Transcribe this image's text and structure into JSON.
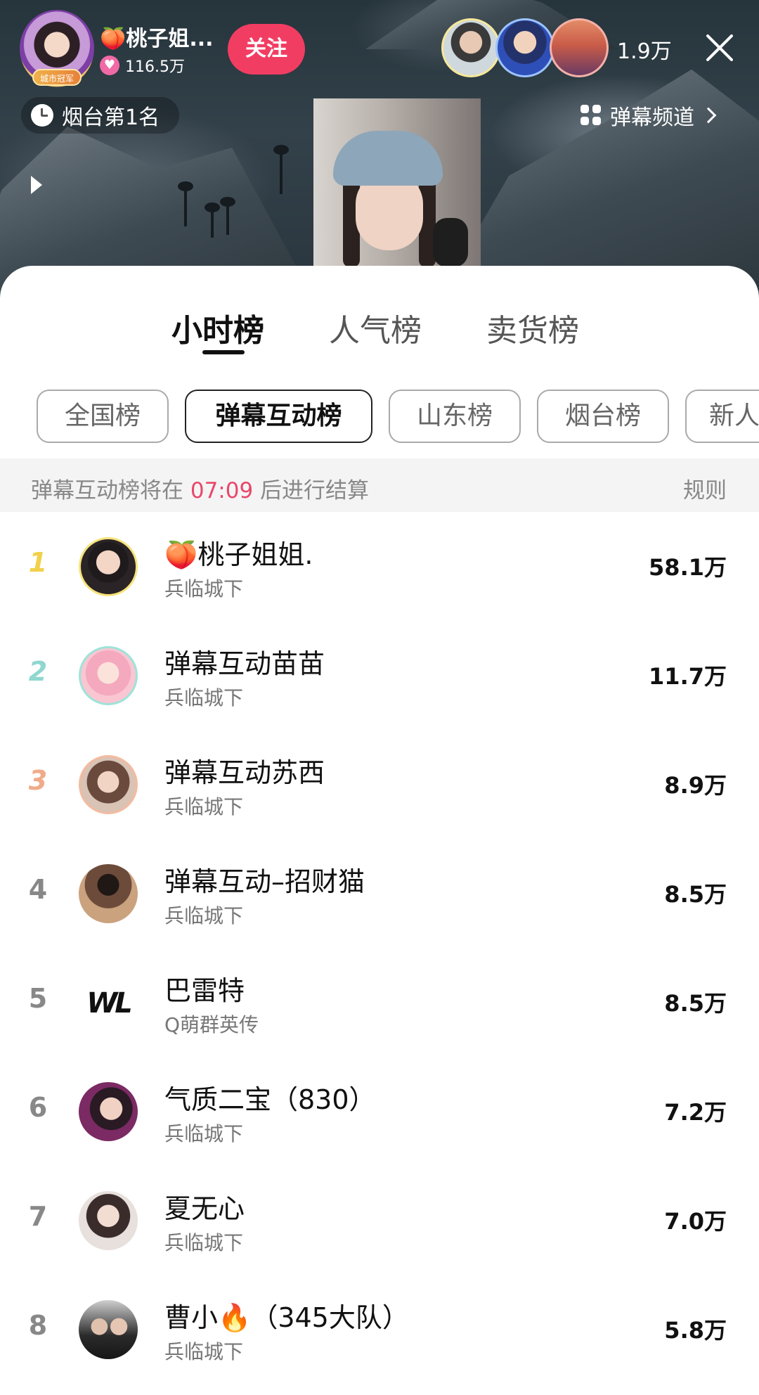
{
  "live_room": {
    "streamer_name": "🍑桃子姐...",
    "streamer_badge": "城市冠军",
    "likes": "116.5万",
    "follow_label": "关注",
    "viewer_count": "1.9万",
    "city_rank": "烟台第1名",
    "danmu_channel": "弹幕频道"
  },
  "icons": {
    "heart": "♥",
    "close": "close-icon",
    "clock": "clock-icon",
    "grid": "grid-icon",
    "chevron": "chevron-right-icon",
    "play": "play-icon"
  },
  "main_tabs": [
    {
      "label": "小时榜",
      "active": true
    },
    {
      "label": "人气榜",
      "active": false
    },
    {
      "label": "卖货榜",
      "active": false
    }
  ],
  "sub_tabs": [
    {
      "label": "全国榜",
      "active": false
    },
    {
      "label": "弹幕互动榜",
      "active": true
    },
    {
      "label": "山东榜",
      "active": false
    },
    {
      "label": "烟台榜",
      "active": false
    },
    {
      "label": "新人",
      "active": false
    }
  ],
  "notice": {
    "prefix": "弹幕互动榜将在",
    "time": "07:09",
    "suffix": "后进行结算",
    "rules_label": "规则"
  },
  "ranking": [
    {
      "rank": "1",
      "name": "🍑桃子姐姐.",
      "subtitle": "兵临城下",
      "score": "58.1万"
    },
    {
      "rank": "2",
      "name": "弹幕互动苗苗",
      "subtitle": "兵临城下",
      "score": "11.7万"
    },
    {
      "rank": "3",
      "name": "弹幕互动苏西",
      "subtitle": "兵临城下",
      "score": "8.9万"
    },
    {
      "rank": "4",
      "name": "弹幕互动–招财猫",
      "subtitle": "兵临城下",
      "score": "8.5万"
    },
    {
      "rank": "5",
      "name": "巴雷特",
      "subtitle": "Q萌群英传",
      "score": "8.5万",
      "logo_text": "WL"
    },
    {
      "rank": "6",
      "name": "气质二宝（830）",
      "subtitle": "兵临城下",
      "score": "7.2万"
    },
    {
      "rank": "7",
      "name": "夏无心",
      "subtitle": "兵临城下",
      "score": "7.0万"
    },
    {
      "rank": "8",
      "name": "曹小🔥（345大队）",
      "subtitle": "兵临城下",
      "score": "5.8万"
    }
  ],
  "colors": {
    "accent_pink": "#f23d63",
    "countdown_red": "#e9476a",
    "rank1_gold": "#f1d14a",
    "rank2_teal": "#8fd7cf",
    "rank3_peach": "#f0ab8a"
  }
}
